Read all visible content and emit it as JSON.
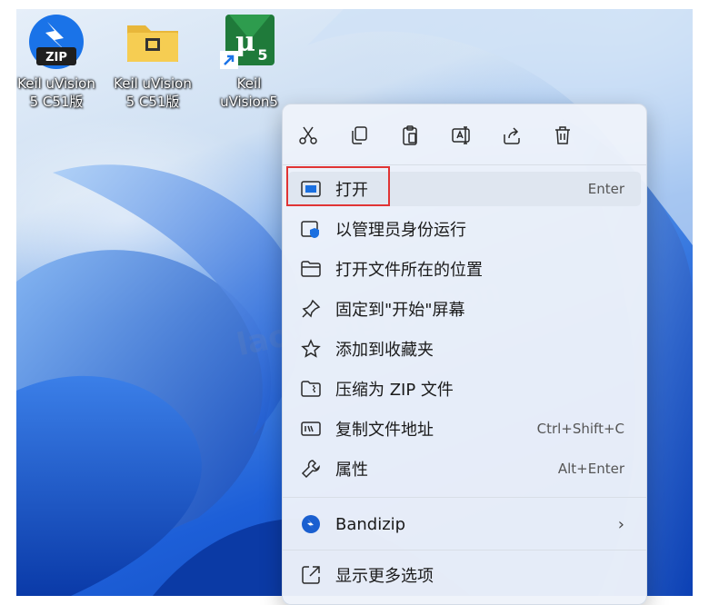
{
  "desktop": {
    "icons": [
      {
        "label_line1": "Keil uVision",
        "label_line2": "5 C51版",
        "icon": "zip-archive-icon",
        "badge": "ZIP"
      },
      {
        "label_line1": "Keil uVision",
        "label_line2": "5 C51版",
        "icon": "folder-icon"
      },
      {
        "label_line1": "Keil",
        "label_line2": "uVision5",
        "icon": "keil-uvision-icon",
        "badge_main": "μ",
        "badge_sub": "5"
      }
    ],
    "watermark": "laowangpython"
  },
  "context_menu": {
    "toolbar": [
      {
        "name": "cut",
        "icon": "scissors-icon"
      },
      {
        "name": "copy",
        "icon": "copy-icon"
      },
      {
        "name": "paste",
        "icon": "clipboard-icon"
      },
      {
        "name": "rename",
        "icon": "rename-icon"
      },
      {
        "name": "share",
        "icon": "share-icon"
      },
      {
        "name": "delete",
        "icon": "trash-icon"
      }
    ],
    "items": [
      {
        "label": "打开",
        "shortcut": "Enter",
        "icon": "open-window-icon",
        "highlighted": true
      },
      {
        "label": "以管理员身份运行",
        "shortcut": "",
        "icon": "shield-window-icon"
      },
      {
        "label": "打开文件所在的位置",
        "shortcut": "",
        "icon": "folder-outline-icon"
      },
      {
        "label": "固定到\"开始\"屏幕",
        "shortcut": "",
        "icon": "pin-icon"
      },
      {
        "label": "添加到收藏夹",
        "shortcut": "",
        "icon": "star-icon"
      },
      {
        "label": "压缩为 ZIP 文件",
        "shortcut": "",
        "icon": "zip-folder-icon"
      },
      {
        "label": "复制文件地址",
        "shortcut": "Ctrl+Shift+C",
        "icon": "copy-path-icon"
      },
      {
        "label": "属性",
        "shortcut": "Alt+Enter",
        "icon": "wrench-icon"
      },
      {
        "label": "Bandizip",
        "shortcut": "",
        "icon": "bandizip-icon",
        "submenu": true
      },
      {
        "label": "显示更多选项",
        "shortcut": "",
        "icon": "more-options-icon"
      }
    ]
  },
  "colors": {
    "highlight_border": "#e03434",
    "menu_bg": "#eef3fa",
    "wallpaper_blue": "#1d5fd8"
  }
}
